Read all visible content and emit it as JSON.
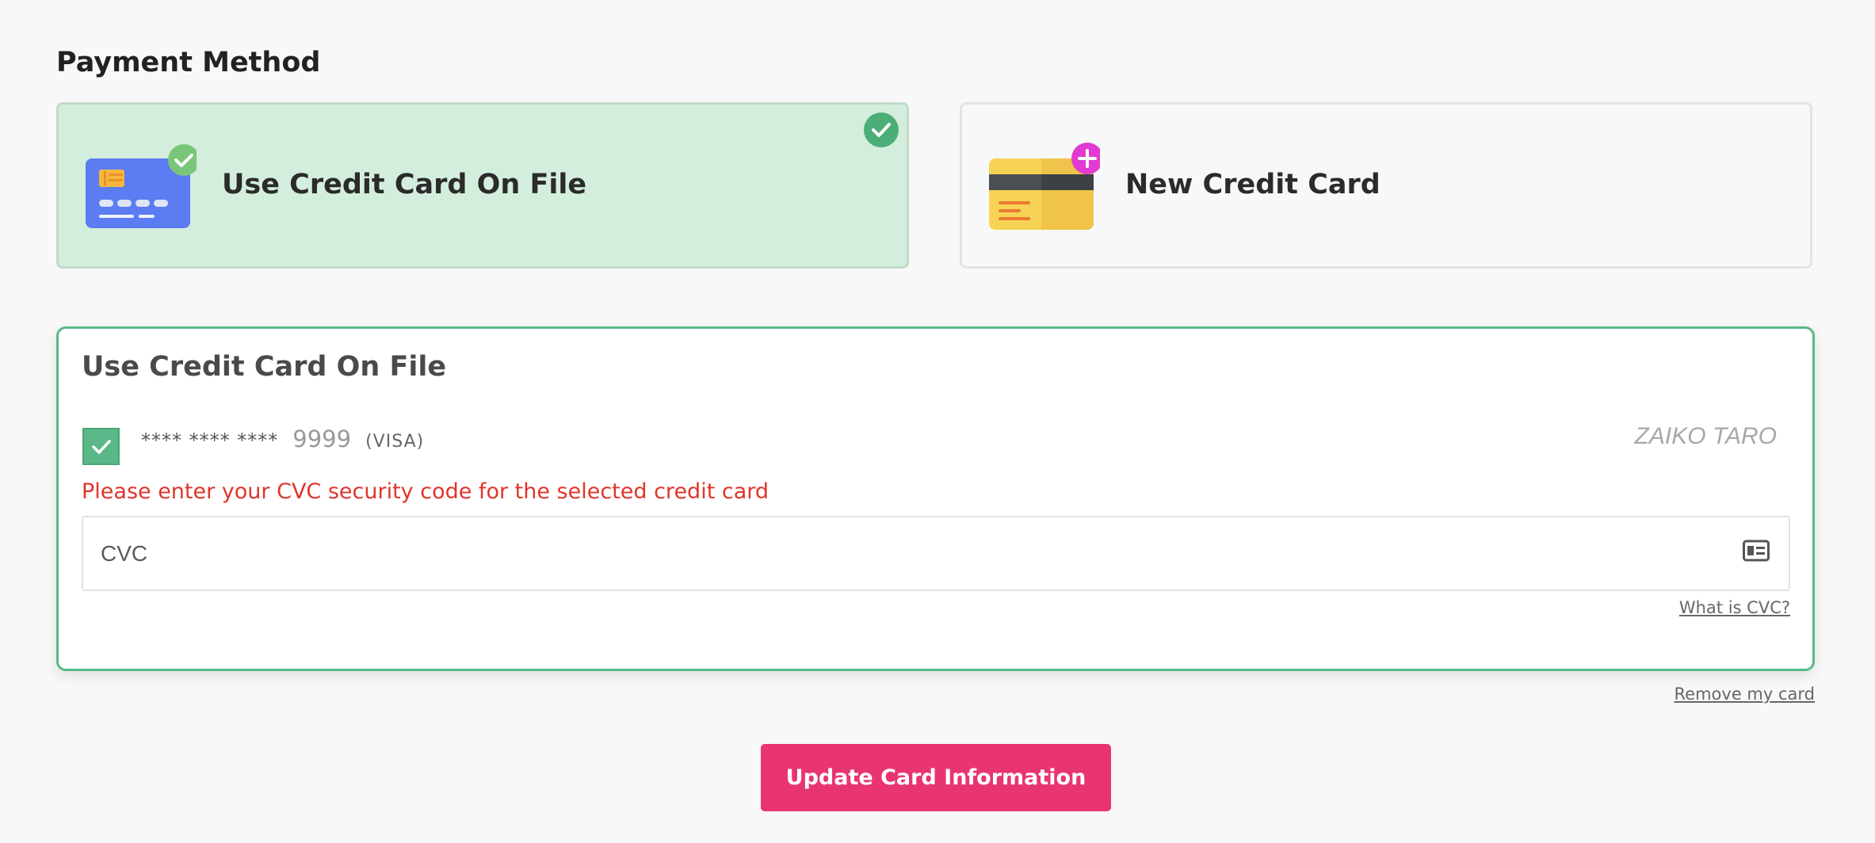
{
  "page": {
    "title": "Payment Method"
  },
  "payment_options": [
    {
      "label": "Use Credit Card On File",
      "selected": true,
      "icon": "credit-card-blue-icon",
      "badge_icon": "check-badge-icon"
    },
    {
      "label": "New Credit Card",
      "selected": false,
      "icon": "credit-card-yellow-icon",
      "badge_icon": "plus-badge-icon"
    }
  ],
  "saved_card": {
    "panel_title": "Use Credit Card On File",
    "checked": true,
    "mask": "**** **** ****",
    "last4": "9999",
    "brand": "(VISA)",
    "holder_name": "ZAIKO TARO",
    "error_message": "Please enter your CVC security code for the selected credit card",
    "cvc_placeholder": "CVC",
    "cvc_value": "",
    "what_is_cvc_label": "What is CVC?"
  },
  "remove_card_label": "Remove my card",
  "update_button_label": "Update Card Information",
  "colors": {
    "accent_green": "#5ab888",
    "selected_bg": "#d4eedd",
    "primary_button": "#e93474",
    "error_red": "#e0352b",
    "card_blue": "#5b7cf2",
    "card_yellow": "#f6d354",
    "badge_magenta": "#e33ad3"
  }
}
